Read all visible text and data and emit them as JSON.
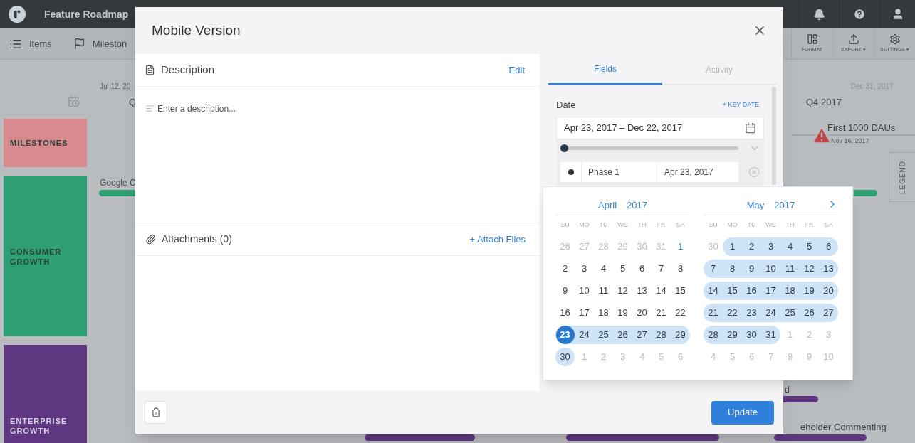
{
  "app": {
    "title": "Feature Roadmap"
  },
  "toolbar": {
    "left": [
      {
        "label": "Items"
      },
      {
        "label": "Mileston"
      }
    ],
    "right": [
      {
        "label": "FORMAT"
      },
      {
        "label": "EXPORT ▾"
      },
      {
        "label": "SETTINGS ▾"
      }
    ]
  },
  "timeline": {
    "start_date": "Jul 12, 20",
    "start_quarter": "Q",
    "end_date": "Dec 31, 2017",
    "end_quarter": "Q4 2017",
    "legend": "LEGEND",
    "milestone": {
      "title": "First 1000 DAUs",
      "date": "Nov 16, 2017"
    },
    "bar_labels": [
      "Google C",
      "d",
      "eholder Commenting"
    ]
  },
  "lanes": [
    {
      "label": "MILESTONES",
      "color": "#d98a8f"
    },
    {
      "label": "CONSUMER GROWTH",
      "color": "#2e9e73"
    },
    {
      "label": "ENTERPRISE GROWTH",
      "color": "#5e3780"
    }
  ],
  "modal": {
    "title": "Mobile Version",
    "description": {
      "heading": "Description",
      "action": "Edit",
      "placeholder": "Enter a description..."
    },
    "attachments": {
      "heading": "Attachments (0)",
      "action": "+ Attach Files"
    },
    "tabs": [
      {
        "label": "Fields",
        "selected": true
      },
      {
        "label": "Activity",
        "selected": false
      }
    ],
    "date": {
      "label": "Date",
      "action": "+ KEY DATE",
      "value": "Apr 23, 2017 – Dec 22, 2017",
      "level": 0
    },
    "phase": {
      "name": "Phase 1",
      "date": "Apr 23, 2017"
    },
    "update": "Update"
  },
  "calendar": {
    "months": [
      {
        "month": "April",
        "year": "2017",
        "weekdays": [
          "SU",
          "MO",
          "TU",
          "WE",
          "TH",
          "FR",
          "SA"
        ],
        "weeks": [
          [
            {
              "day": "26",
              "kind": "other"
            },
            {
              "day": "27",
              "kind": "other"
            },
            {
              "day": "28",
              "kind": "other"
            },
            {
              "day": "29",
              "kind": "other"
            },
            {
              "day": "30",
              "kind": "other"
            },
            {
              "day": "31",
              "kind": "other"
            },
            {
              "day": "1",
              "kind": "today"
            }
          ],
          [
            {
              "day": "2",
              "kind": "normal"
            },
            {
              "day": "3",
              "kind": "normal"
            },
            {
              "day": "4",
              "kind": "normal"
            },
            {
              "day": "5",
              "kind": "normal"
            },
            {
              "day": "6",
              "kind": "normal"
            },
            {
              "day": "7",
              "kind": "normal"
            },
            {
              "day": "8",
              "kind": "normal"
            }
          ],
          [
            {
              "day": "9",
              "kind": "normal"
            },
            {
              "day": "10",
              "kind": "normal"
            },
            {
              "day": "11",
              "kind": "normal"
            },
            {
              "day": "12",
              "kind": "normal"
            },
            {
              "day": "13",
              "kind": "normal"
            },
            {
              "day": "14",
              "kind": "normal"
            },
            {
              "day": "15",
              "kind": "normal"
            }
          ],
          [
            {
              "day": "16",
              "kind": "normal"
            },
            {
              "day": "17",
              "kind": "normal"
            },
            {
              "day": "18",
              "kind": "normal"
            },
            {
              "day": "19",
              "kind": "normal"
            },
            {
              "day": "20",
              "kind": "normal"
            },
            {
              "day": "21",
              "kind": "normal"
            },
            {
              "day": "22",
              "kind": "normal"
            }
          ],
          [
            {
              "day": "23",
              "kind": "start"
            },
            {
              "day": "24",
              "kind": "range"
            },
            {
              "day": "25",
              "kind": "range"
            },
            {
              "day": "26",
              "kind": "range"
            },
            {
              "day": "27",
              "kind": "range"
            },
            {
              "day": "28",
              "kind": "range"
            },
            {
              "day": "29",
              "kind": "range"
            }
          ],
          [
            {
              "day": "30",
              "kind": "range"
            },
            {
              "day": "1",
              "kind": "other"
            },
            {
              "day": "2",
              "kind": "other"
            },
            {
              "day": "3",
              "kind": "other"
            },
            {
              "day": "4",
              "kind": "other"
            },
            {
              "day": "5",
              "kind": "other"
            },
            {
              "day": "6",
              "kind": "other"
            }
          ]
        ]
      },
      {
        "month": "May",
        "year": "2017",
        "weekdays": [
          "SU",
          "MO",
          "TU",
          "WE",
          "TH",
          "FR",
          "SA"
        ],
        "weeks": [
          [
            {
              "day": "30",
              "kind": "other"
            },
            {
              "day": "1",
              "kind": "range"
            },
            {
              "day": "2",
              "kind": "range"
            },
            {
              "day": "3",
              "kind": "range"
            },
            {
              "day": "4",
              "kind": "range"
            },
            {
              "day": "5",
              "kind": "range"
            },
            {
              "day": "6",
              "kind": "range"
            }
          ],
          [
            {
              "day": "7",
              "kind": "range"
            },
            {
              "day": "8",
              "kind": "range"
            },
            {
              "day": "9",
              "kind": "range"
            },
            {
              "day": "10",
              "kind": "range"
            },
            {
              "day": "11",
              "kind": "range"
            },
            {
              "day": "12",
              "kind": "range"
            },
            {
              "day": "13",
              "kind": "range"
            }
          ],
          [
            {
              "day": "14",
              "kind": "range"
            },
            {
              "day": "15",
              "kind": "range"
            },
            {
              "day": "16",
              "kind": "range"
            },
            {
              "day": "17",
              "kind": "range"
            },
            {
              "day": "18",
              "kind": "range"
            },
            {
              "day": "19",
              "kind": "range"
            },
            {
              "day": "20",
              "kind": "range"
            }
          ],
          [
            {
              "day": "21",
              "kind": "range"
            },
            {
              "day": "22",
              "kind": "range"
            },
            {
              "day": "23",
              "kind": "range"
            },
            {
              "day": "24",
              "kind": "range"
            },
            {
              "day": "25",
              "kind": "range"
            },
            {
              "day": "26",
              "kind": "range"
            },
            {
              "day": "27",
              "kind": "range"
            }
          ],
          [
            {
              "day": "28",
              "kind": "range"
            },
            {
              "day": "29",
              "kind": "range"
            },
            {
              "day": "30",
              "kind": "range"
            },
            {
              "day": "31",
              "kind": "range"
            },
            {
              "day": "1",
              "kind": "other"
            },
            {
              "day": "2",
              "kind": "other"
            },
            {
              "day": "3",
              "kind": "other"
            }
          ],
          [
            {
              "day": "4",
              "kind": "other"
            },
            {
              "day": "5",
              "kind": "other"
            },
            {
              "day": "6",
              "kind": "other"
            },
            {
              "day": "7",
              "kind": "other"
            },
            {
              "day": "8",
              "kind": "other"
            },
            {
              "day": "9",
              "kind": "other"
            },
            {
              "day": "10",
              "kind": "other"
            }
          ]
        ]
      }
    ]
  }
}
